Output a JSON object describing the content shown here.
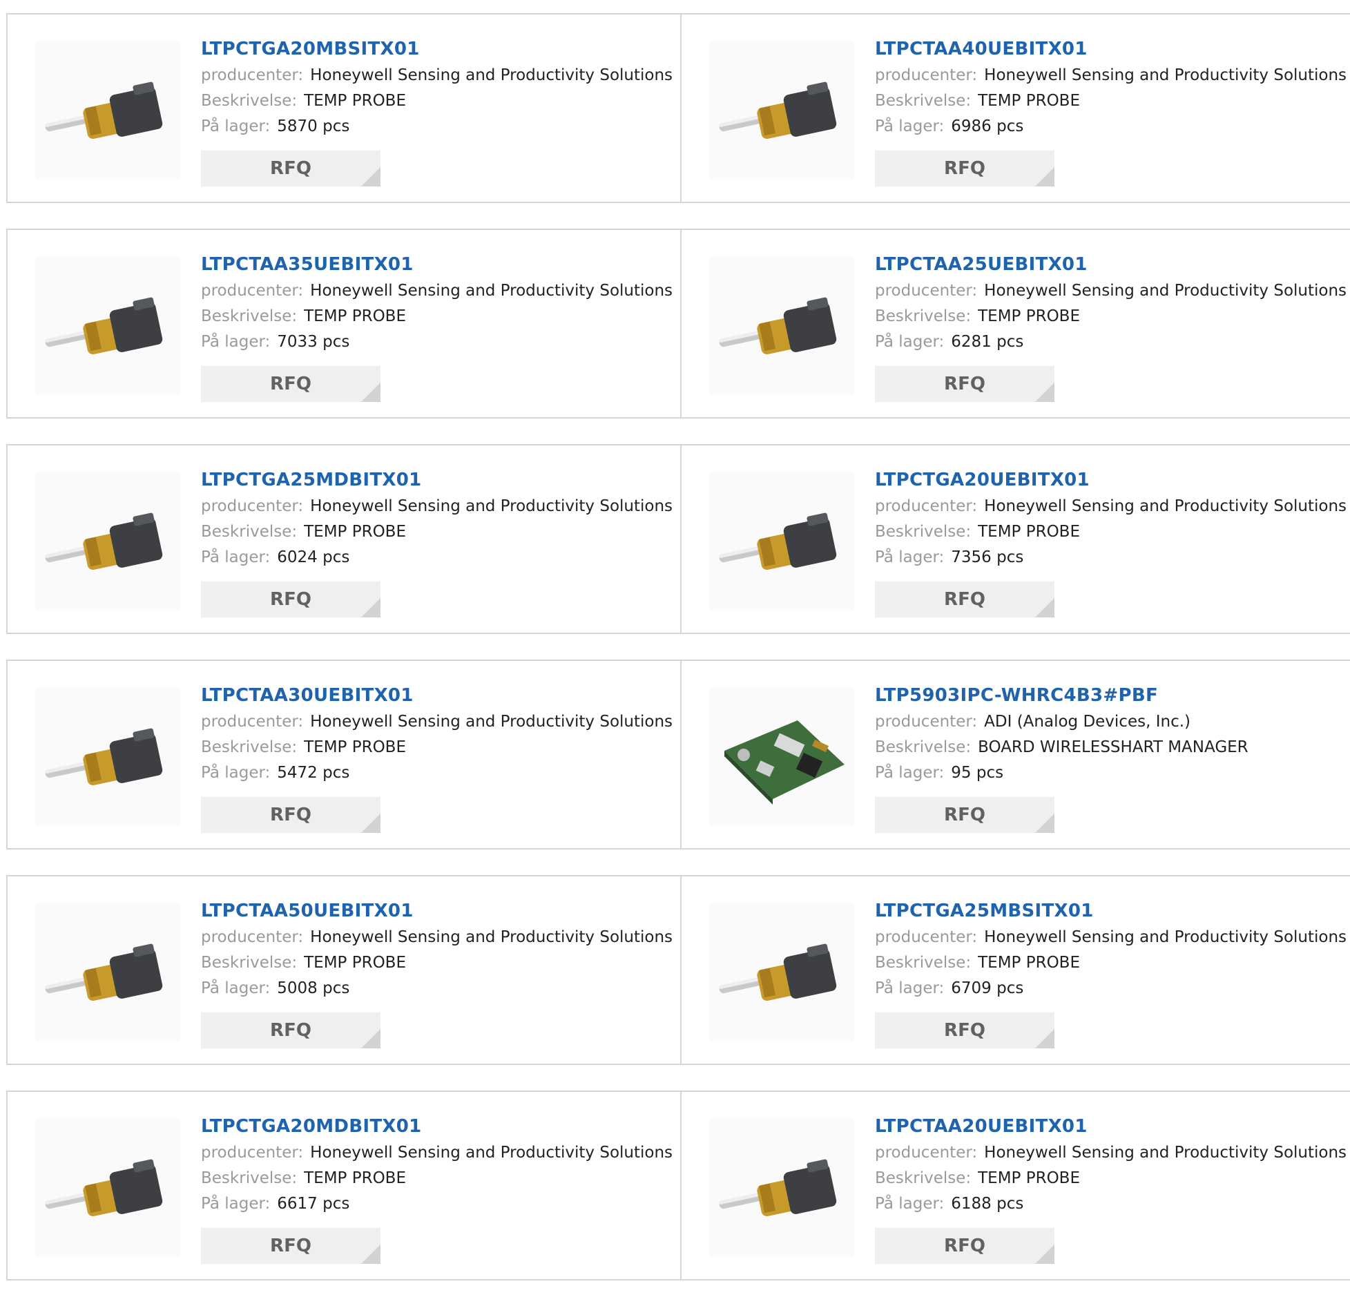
{
  "labels": {
    "manufacturer": "producenter:",
    "description": "Beskrivelse:",
    "stock": "På lager:",
    "rfq": "RFQ"
  },
  "products": [
    {
      "part": "LTPCTGA20MBSITX01",
      "manufacturer": "Honeywell Sensing and Productivity Solutions",
      "description": "TEMP PROBE",
      "stock": "5870 pcs",
      "image": "temp-probe-image"
    },
    {
      "part": "LTPCTAA40UEBITX01",
      "manufacturer": "Honeywell Sensing and Productivity Solutions",
      "description": "TEMP PROBE",
      "stock": "6986 pcs",
      "image": "temp-probe-image"
    },
    {
      "part": "LTPCTAA35UEBITX01",
      "manufacturer": "Honeywell Sensing and Productivity Solutions",
      "description": "TEMP PROBE",
      "stock": "7033 pcs",
      "image": "temp-probe-image"
    },
    {
      "part": "LTPCTAA25UEBITX01",
      "manufacturer": "Honeywell Sensing and Productivity Solutions",
      "description": "TEMP PROBE",
      "stock": "6281 pcs",
      "image": "temp-probe-image"
    },
    {
      "part": "LTPCTGA25MDBITX01",
      "manufacturer": "Honeywell Sensing and Productivity Solutions",
      "description": "TEMP PROBE",
      "stock": "6024 pcs",
      "image": "temp-probe-image"
    },
    {
      "part": "LTPCTGA20UEBITX01",
      "manufacturer": "Honeywell Sensing and Productivity Solutions",
      "description": "TEMP PROBE",
      "stock": "7356 pcs",
      "image": "temp-probe-image"
    },
    {
      "part": "LTPCTAA30UEBITX01",
      "manufacturer": "Honeywell Sensing and Productivity Solutions",
      "description": "TEMP PROBE",
      "stock": "5472 pcs",
      "image": "temp-probe-image"
    },
    {
      "part": "LTP5903IPC-WHRC4B3#PBF",
      "manufacturer": "ADI (Analog Devices, Inc.)",
      "description": "BOARD WIRELESSHART MANAGER",
      "stock": "95 pcs",
      "image": "circuit-board-image"
    },
    {
      "part": "LTPCTAA50UEBITX01",
      "manufacturer": "Honeywell Sensing and Productivity Solutions",
      "description": "TEMP PROBE",
      "stock": "5008 pcs",
      "image": "temp-probe-image"
    },
    {
      "part": "LTPCTGA25MBSITX01",
      "manufacturer": "Honeywell Sensing and Productivity Solutions",
      "description": "TEMP PROBE",
      "stock": "6709 pcs",
      "image": "temp-probe-image"
    },
    {
      "part": "LTPCTGA20MDBITX01",
      "manufacturer": "Honeywell Sensing and Productivity Solutions",
      "description": "TEMP PROBE",
      "stock": "6617 pcs",
      "image": "temp-probe-image"
    },
    {
      "part": "LTPCTAA20UEBITX01",
      "manufacturer": "Honeywell Sensing and Productivity Solutions",
      "description": "TEMP PROBE",
      "stock": "6188 pcs",
      "image": "temp-probe-image"
    }
  ]
}
